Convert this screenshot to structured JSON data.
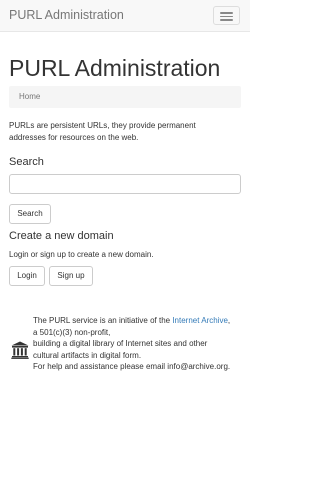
{
  "navbar": {
    "brand": "PURL Administration",
    "menu_toggle_icon": "hamburger-menu-icon"
  },
  "page": {
    "title": "PURL Administration",
    "breadcrumb": [
      "Home"
    ],
    "intro": "PURLs are persistent URLs, they provide permanent addresses for resources on the web."
  },
  "search": {
    "heading": "Search",
    "input_value": "",
    "placeholder": "",
    "button_label": "Search"
  },
  "create": {
    "heading": "Create a new domain",
    "note": "Login or sign up to create a new domain.",
    "login_label": "Login",
    "signup_label": "Sign up"
  },
  "footer": {
    "icon": "institution-icon",
    "text_before_link": "The PURL service is an initiative of the ",
    "link_text": "Internet Archive",
    "text_after_link": ", a 501(c)(3) non-profit,",
    "line2": "building a digital library of Internet sites and other cultural artifacts in digital form.",
    "line3": "For help and assistance please email info@archive.org."
  },
  "colors": {
    "link": "#337ab7",
    "navbar_bg": "#f8f8f8",
    "breadcrumb_bg": "#f5f5f5",
    "text": "#333333"
  }
}
